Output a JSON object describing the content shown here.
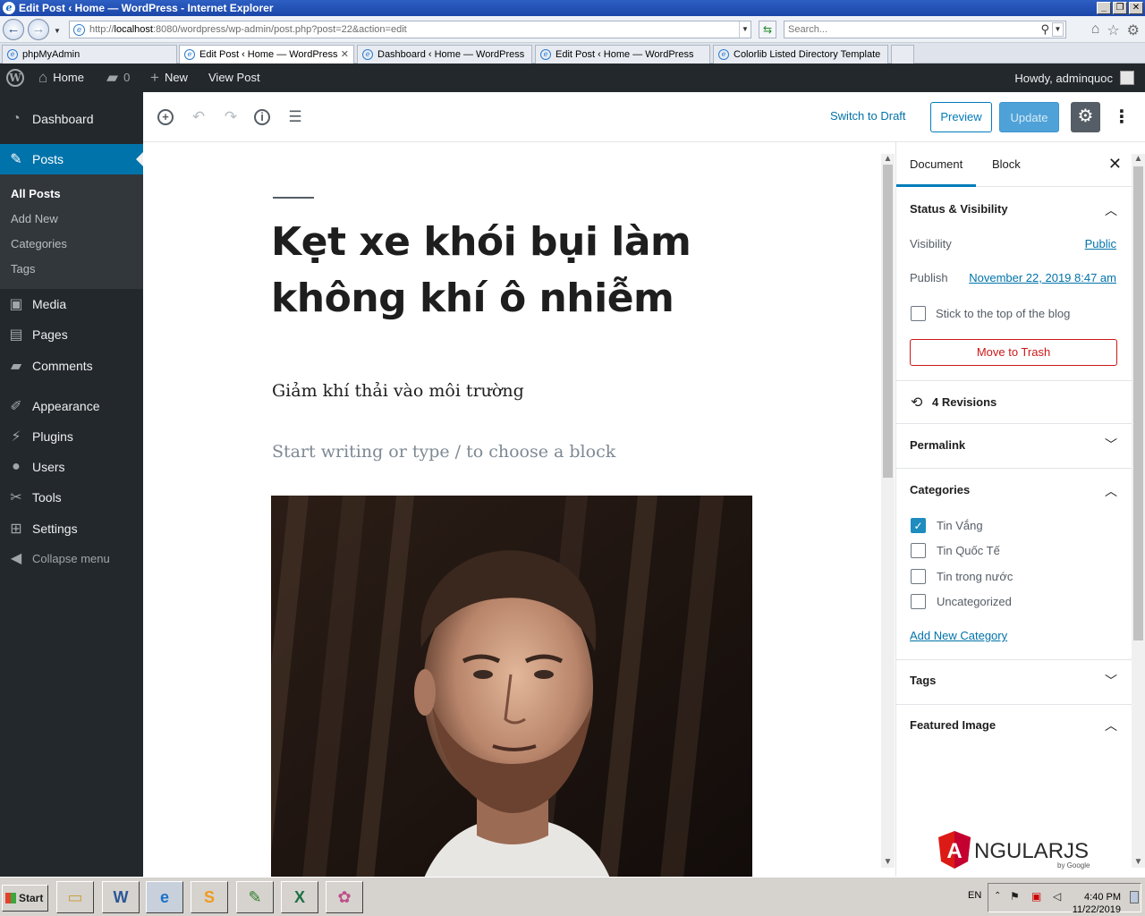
{
  "window": {
    "title": "Edit Post ‹ Home — WordPress - Internet Explorer",
    "url_prefix": "http://",
    "url_host": "localhost",
    "url_rest": ":8080/wordpress/wp-admin/post.php?post=22&action=edit",
    "search_placeholder": "Search...",
    "tabs": [
      {
        "label": "phpMyAdmin"
      },
      {
        "label": "Edit Post ‹ Home — WordPress"
      },
      {
        "label": "Dashboard ‹ Home — WordPress"
      },
      {
        "label": "Edit Post ‹ Home — WordPress"
      },
      {
        "label": "Colorlib Listed Directory Template"
      }
    ]
  },
  "adminbar": {
    "home": "Home",
    "comments_count": "0",
    "new": "New",
    "view_post": "View Post",
    "howdy": "Howdy, adminquoc"
  },
  "sidebar": {
    "dashboard": "Dashboard",
    "posts": "Posts",
    "sub": [
      "All Posts",
      "Add New",
      "Categories",
      "Tags"
    ],
    "media": "Media",
    "pages": "Pages",
    "comments": "Comments",
    "appearance": "Appearance",
    "plugins": "Plugins",
    "users": "Users",
    "tools": "Tools",
    "settings": "Settings",
    "collapse": "Collapse menu"
  },
  "header": {
    "switch_to_draft": "Switch to Draft",
    "preview": "Preview",
    "update": "Update"
  },
  "post": {
    "title": "Kẹt xe khói bụi làm không khí ô nhiễm",
    "paragraph": "Giảm khí thải vào môi trường",
    "placeholder": "Start writing or type / to choose a block"
  },
  "settings": {
    "tab_document": "Document",
    "tab_block": "Block",
    "status_visibility": "Status & Visibility",
    "visibility_label": "Visibility",
    "visibility_value": "Public",
    "publish_label": "Publish",
    "publish_value": "November 22, 2019 8:47 am",
    "stick_top": "Stick to the top of the blog",
    "move_trash": "Move to Trash",
    "revisions": "4 Revisions",
    "permalink": "Permalink",
    "categories": "Categories",
    "category_items": [
      {
        "label": "Tin Vắng",
        "checked": true
      },
      {
        "label": "Tin Quốc Tế",
        "checked": false
      },
      {
        "label": "Tin trong nước",
        "checked": false
      },
      {
        "label": "Uncategorized",
        "checked": false
      }
    ],
    "add_category": "Add New Category",
    "tags": "Tags",
    "featured_image": "Featured Image",
    "angular_logo_text": "NGULARJS",
    "angular_by": "by Google"
  },
  "taskbar": {
    "start": "Start",
    "lang": "EN",
    "time": "4:40 PM",
    "date": "11/22/2019"
  }
}
